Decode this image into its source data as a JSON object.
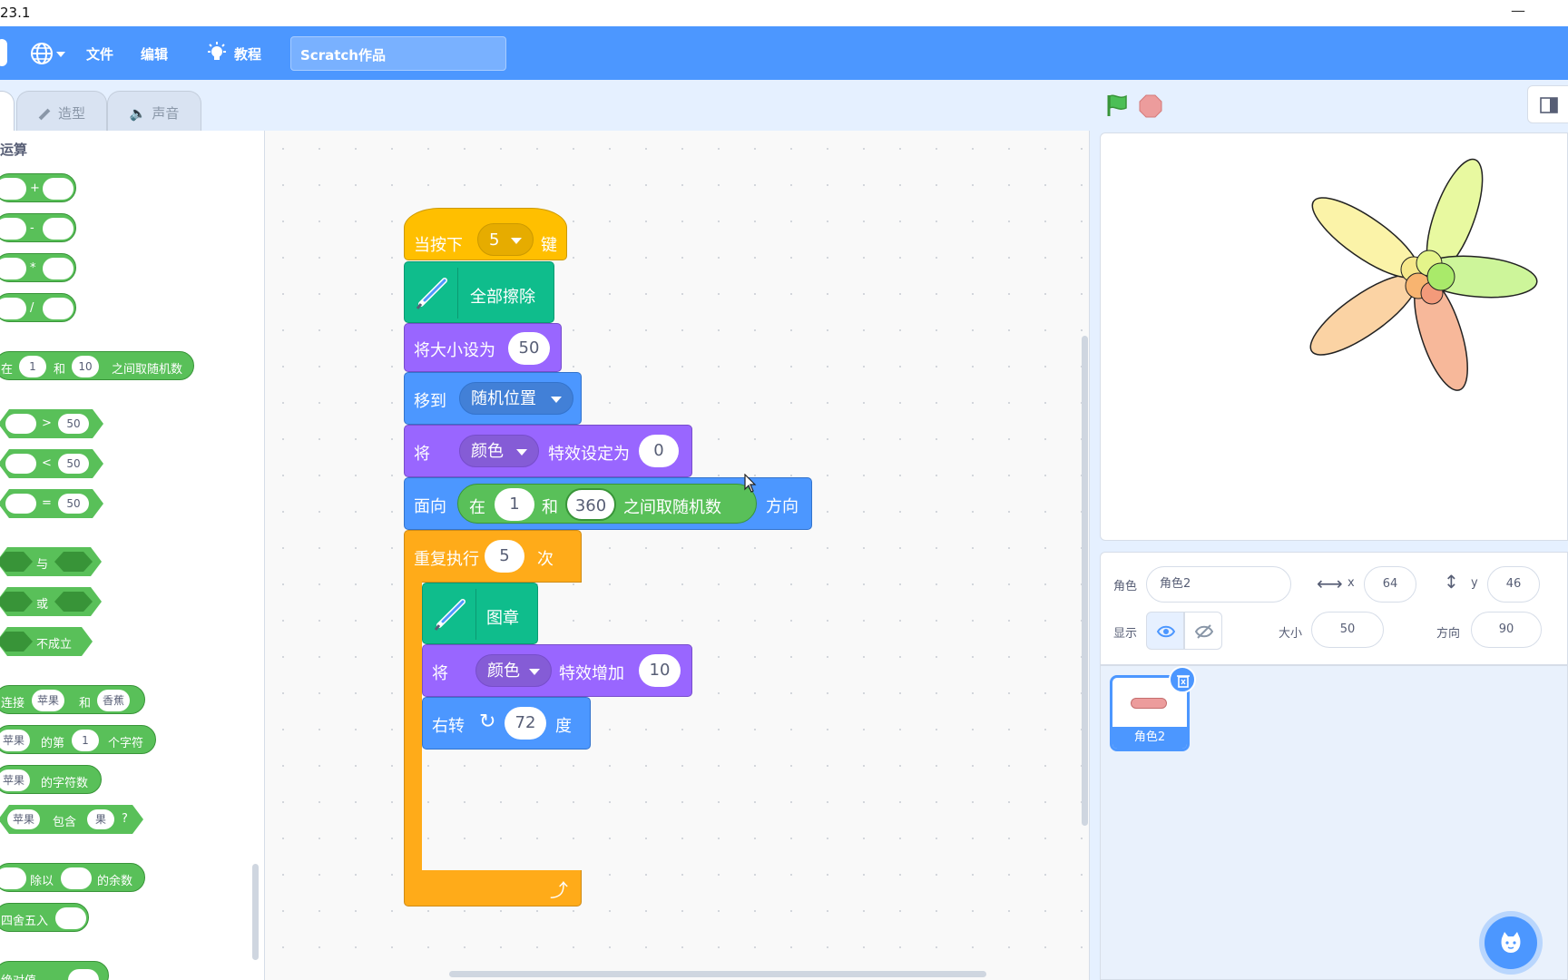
{
  "window": {
    "title_fragment": "23.1",
    "minimize": "—"
  },
  "menu": {
    "file": "文件",
    "edit": "编辑",
    "tutorials": "教程",
    "project_title": "Scratch作品"
  },
  "tabs": {
    "costumes": "造型",
    "sounds": "声音"
  },
  "palette": {
    "category": "运算",
    "ops": [
      "+",
      "-",
      "*",
      "/"
    ],
    "random": {
      "prefix": "在",
      "a": "1",
      "mid": "和",
      "b": "10",
      "suffix": "之间取随机数"
    },
    "compare": [
      {
        "op": ">",
        "value": "50"
      },
      {
        "op": "<",
        "value": "50"
      },
      {
        "op": "=",
        "value": "50"
      }
    ],
    "logic": {
      "and": "与",
      "or": "或",
      "not": "不成立"
    },
    "join": {
      "label": "连接",
      "a": "苹果",
      "mid": "和",
      "b": "香蕉"
    },
    "letter": {
      "a": "苹果",
      "mid": "的第",
      "n": "1",
      "suffix": "个字符"
    },
    "length": {
      "a": "苹果",
      "suffix": "的字符数"
    },
    "contains": {
      "a": "苹果",
      "mid": "包含",
      "b": "果",
      "suffix": "?"
    },
    "mod": {
      "mid": "除以",
      "suffix": "的余数"
    },
    "round": {
      "label": "四舍五入"
    },
    "abs": {
      "label": "绝对值"
    }
  },
  "script": {
    "hat": {
      "prefix": "当按下",
      "key": "5",
      "suffix": "键"
    },
    "clear": {
      "label": "全部擦除"
    },
    "setsize": {
      "label": "将大小设为",
      "value": "50"
    },
    "goto": {
      "label": "移到",
      "target": "随机位置"
    },
    "seteffect": {
      "prefix": "将",
      "effect": "颜色",
      "suffix": "特效设定为",
      "value": "0"
    },
    "point": {
      "prefix": "面向",
      "rand_prefix": "在",
      "a": "1",
      "mid": "和",
      "b": "360",
      "rand_suffix": "之间取随机数",
      "suffix": "方向"
    },
    "repeat": {
      "prefix": "重复执行",
      "count": "5",
      "suffix": "次"
    },
    "stamp": {
      "label": "图章"
    },
    "changeeffect": {
      "prefix": "将",
      "effect": "颜色",
      "suffix": "特效增加",
      "value": "10"
    },
    "turn": {
      "prefix": "右转",
      "value": "72",
      "suffix": "度"
    }
  },
  "sprite_info": {
    "sprite_label": "角色",
    "sprite_name": "角色2",
    "x_label": "x",
    "x": "64",
    "y_label": "y",
    "y": "46",
    "show_label": "显示",
    "size_label": "大小",
    "size": "50",
    "dir_label": "方向",
    "direction": "90"
  },
  "sprite_list": [
    {
      "name": "角色2",
      "selected": true
    }
  ],
  "colors": {
    "menu": "#4c97ff",
    "operators": "#59c059",
    "events": "#ffbf00",
    "pen": "#0fbd8c",
    "looks": "#9966ff",
    "motion": "#4c97ff",
    "control": "#ffab19"
  }
}
